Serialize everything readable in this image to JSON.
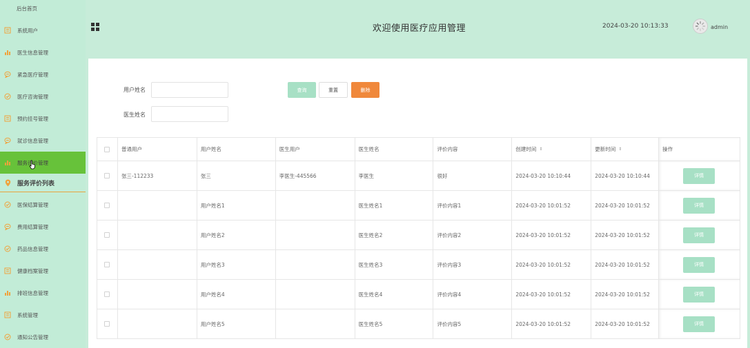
{
  "sidebar": {
    "home": "后台首页",
    "items": [
      {
        "label": "系统用户",
        "icon": "document-icon"
      },
      {
        "label": "医生信息管理",
        "icon": "bar-chart-icon"
      },
      {
        "label": "紧急医疗管理",
        "icon": "chat-icon"
      },
      {
        "label": "医疗咨询管理",
        "icon": "check-circle-icon"
      },
      {
        "label": "预约挂号管理",
        "icon": "document-icon"
      },
      {
        "label": "就诊信息管理",
        "icon": "chat-icon"
      },
      {
        "label": "服务评价管理",
        "icon": "bar-chart-icon"
      }
    ],
    "sub_item": "服务评价列表",
    "items2": [
      {
        "label": "医保结算管理",
        "icon": "check-circle-icon"
      },
      {
        "label": "费用结算管理",
        "icon": "chat-icon"
      },
      {
        "label": "药品信息管理",
        "icon": "check-circle-icon"
      },
      {
        "label": "健康档案管理",
        "icon": "document-icon"
      },
      {
        "label": "排班信息管理",
        "icon": "bar-chart-icon"
      },
      {
        "label": "系统管理",
        "icon": "document-icon"
      },
      {
        "label": "通知公告管理",
        "icon": "check-circle-icon"
      }
    ],
    "accent_color": "#f0a23b",
    "active_color": "#67c23a"
  },
  "header": {
    "title": "欢迎使用医疗应用管理",
    "datetime": "2024-03-20 10:13:33",
    "username": "admin"
  },
  "search": {
    "user_name_label": "用户姓名",
    "user_name_value": "",
    "doctor_name_label": "医生姓名",
    "doctor_name_value": "",
    "query_label": "查询",
    "reset_label": "重置",
    "delete_label": "删除"
  },
  "table": {
    "columns": [
      "普通用户",
      "用户姓名",
      "医生用户",
      "医生姓名",
      "评价内容",
      "创建时间",
      "更新时间",
      "操作"
    ],
    "sort_icon": "⇕",
    "detail_label": "详情",
    "rows": [
      {
        "user": "张三-112233",
        "user_name": "张三",
        "doctor_user": "李医生-445566",
        "doctor_name": "李医生",
        "content": "很好",
        "created": "2024-03-20 10:10:44",
        "updated": "2024-03-20 10:10:44"
      },
      {
        "user": "",
        "user_name": "用户姓名1",
        "doctor_user": "",
        "doctor_name": "医生姓名1",
        "content": "评价内容1",
        "created": "2024-03-20 10:01:52",
        "updated": "2024-03-20 10:01:52"
      },
      {
        "user": "",
        "user_name": "用户姓名2",
        "doctor_user": "",
        "doctor_name": "医生姓名2",
        "content": "评价内容2",
        "created": "2024-03-20 10:01:52",
        "updated": "2024-03-20 10:01:52"
      },
      {
        "user": "",
        "user_name": "用户姓名3",
        "doctor_user": "",
        "doctor_name": "医生姓名3",
        "content": "评价内容3",
        "created": "2024-03-20 10:01:52",
        "updated": "2024-03-20 10:01:52"
      },
      {
        "user": "",
        "user_name": "用户姓名4",
        "doctor_user": "",
        "doctor_name": "医生姓名4",
        "content": "评价内容4",
        "created": "2024-03-20 10:01:52",
        "updated": "2024-03-20 10:01:52"
      },
      {
        "user": "",
        "user_name": "用户姓名5",
        "doctor_user": "",
        "doctor_name": "医生姓名5",
        "content": "评价内容5",
        "created": "2024-03-20 10:01:52",
        "updated": "2024-03-20 10:01:52"
      }
    ]
  }
}
